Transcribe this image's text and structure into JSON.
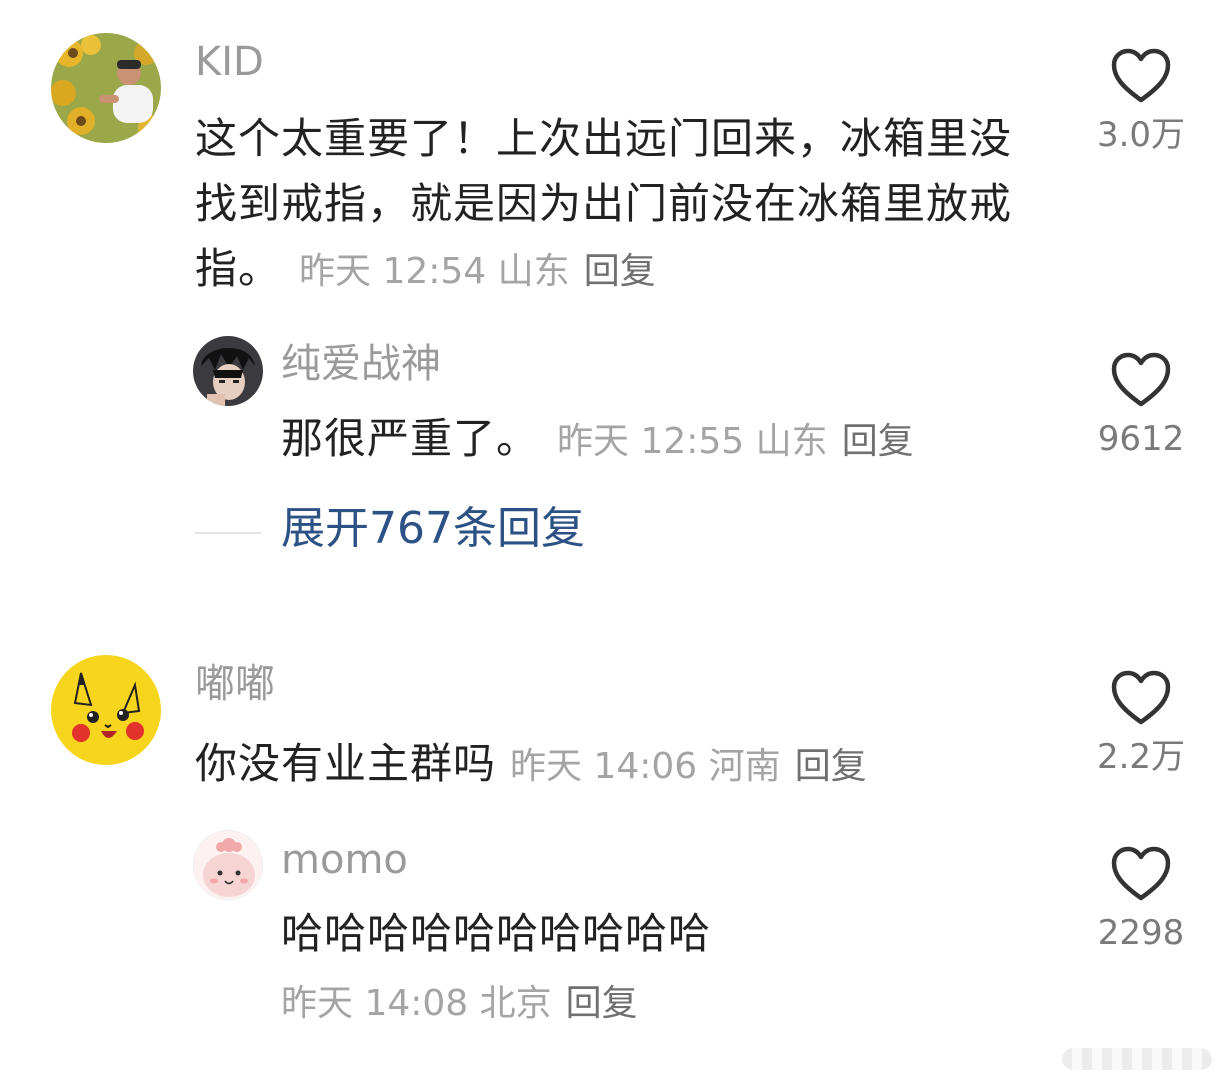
{
  "comments": [
    {
      "username": "KID",
      "text": "这个太重要了！上次出远门回来，冰箱里没找到戒指，就是因为出门前没在冰箱里放戒指。",
      "time": "昨天 12:54",
      "location": "山东",
      "reply_label": "回复",
      "likes": "3.0万",
      "avatar_icon": "avatar-person-sunflower-field",
      "replies": [
        {
          "username": "纯爱战神",
          "text": "那很严重了。",
          "time": "昨天 12:55",
          "location": "山东",
          "reply_label": "回复",
          "likes": "9612",
          "avatar_icon": "avatar-anime-character"
        }
      ],
      "expand_label": "展开767条回复"
    },
    {
      "username": "嘟嘟",
      "text": "你没有业主群吗",
      "time": "昨天 14:06",
      "location": "河南",
      "reply_label": "回复",
      "likes": "2.2万",
      "avatar_icon": "avatar-pikachu",
      "replies": [
        {
          "username": "momo",
          "text": "哈哈哈哈哈哈哈哈哈哈",
          "time": "昨天 14:08",
          "location": "北京",
          "reply_label": "回复",
          "likes": "2298",
          "avatar_icon": "avatar-pink-cartoon"
        }
      ]
    }
  ],
  "colors": {
    "username": "#9a9a9a",
    "body_text": "#222222",
    "meta": "#a4a4a4",
    "expand_link": "#2b5185",
    "like_icon": "#333333"
  }
}
